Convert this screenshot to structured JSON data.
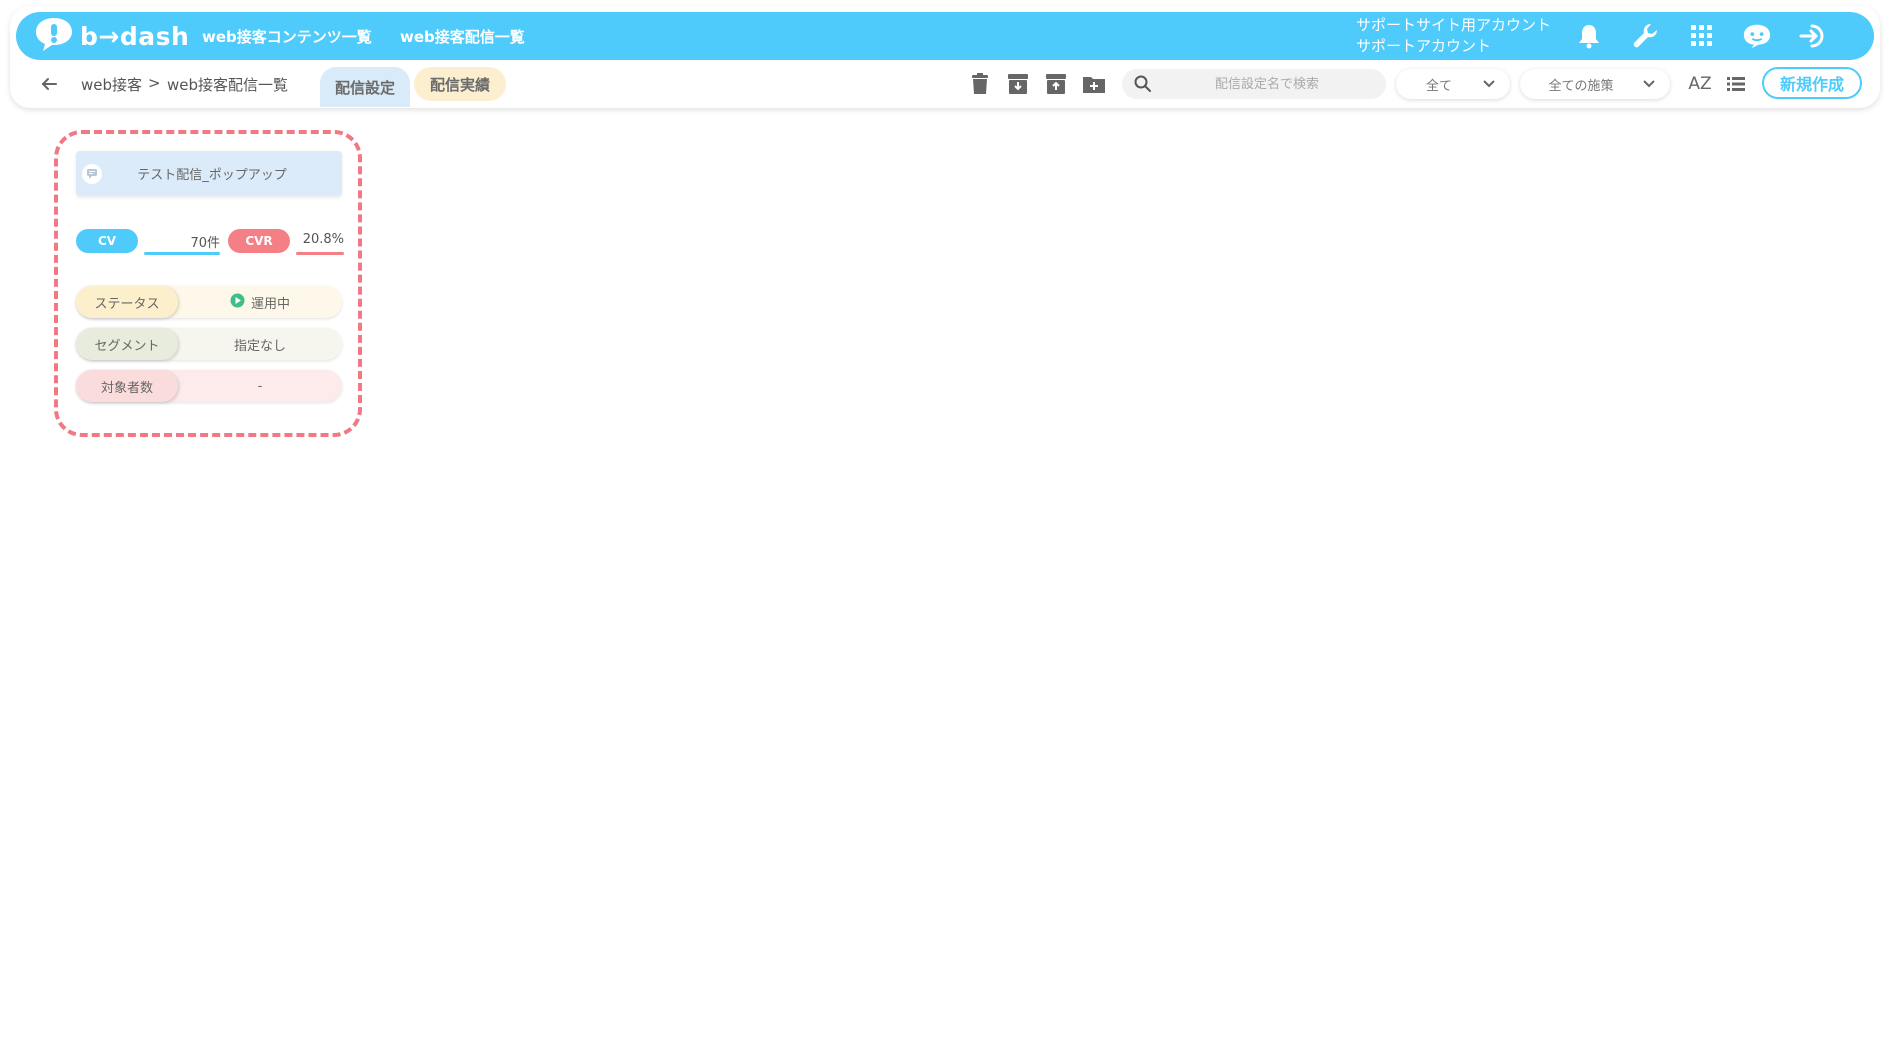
{
  "header": {
    "logo_text": "b→dash",
    "nav": [
      {
        "label": "web接客コンテンツ一覧"
      },
      {
        "label": "web接客配信一覧"
      }
    ],
    "account_line1": "サポートサイト用アカウント",
    "account_line2": "サポートアカウント",
    "icons": [
      "bell-icon",
      "wrench-icon",
      "grid-icon",
      "chat-robot-icon",
      "logout-icon"
    ]
  },
  "subbar": {
    "breadcrumb": {
      "root": "web接客",
      "separator": ">",
      "current": "web接客配信一覧"
    },
    "tabs": [
      {
        "label": "配信設定",
        "active": true
      },
      {
        "label": "配信実績",
        "active": false
      }
    ],
    "search": {
      "placeholder": "配信設定名で検索"
    },
    "filter_status": {
      "value": "全て"
    },
    "filter_measure": {
      "value": "全ての施策"
    },
    "sort_icon_text": "AZ",
    "new_button": "新規作成"
  },
  "card": {
    "title": "テスト配信_ポップアップ",
    "cv_label": "CV",
    "cv_value": "70件",
    "cvr_label": "CVR",
    "cvr_value": "20.8%",
    "rows": [
      {
        "label": "ステータス",
        "value": "運用中"
      },
      {
        "label": "セグメント",
        "value": "指定なし"
      },
      {
        "label": "対象者数",
        "value": "-"
      }
    ]
  },
  "colors": {
    "primary": "#4ecbfb",
    "accent_red": "#f47f85",
    "status_green": "#3fbf86",
    "highlight_outline": "#f07984",
    "tab_settings_bg": "#d9ebf8",
    "tab_results_bg": "#fbefcf"
  }
}
